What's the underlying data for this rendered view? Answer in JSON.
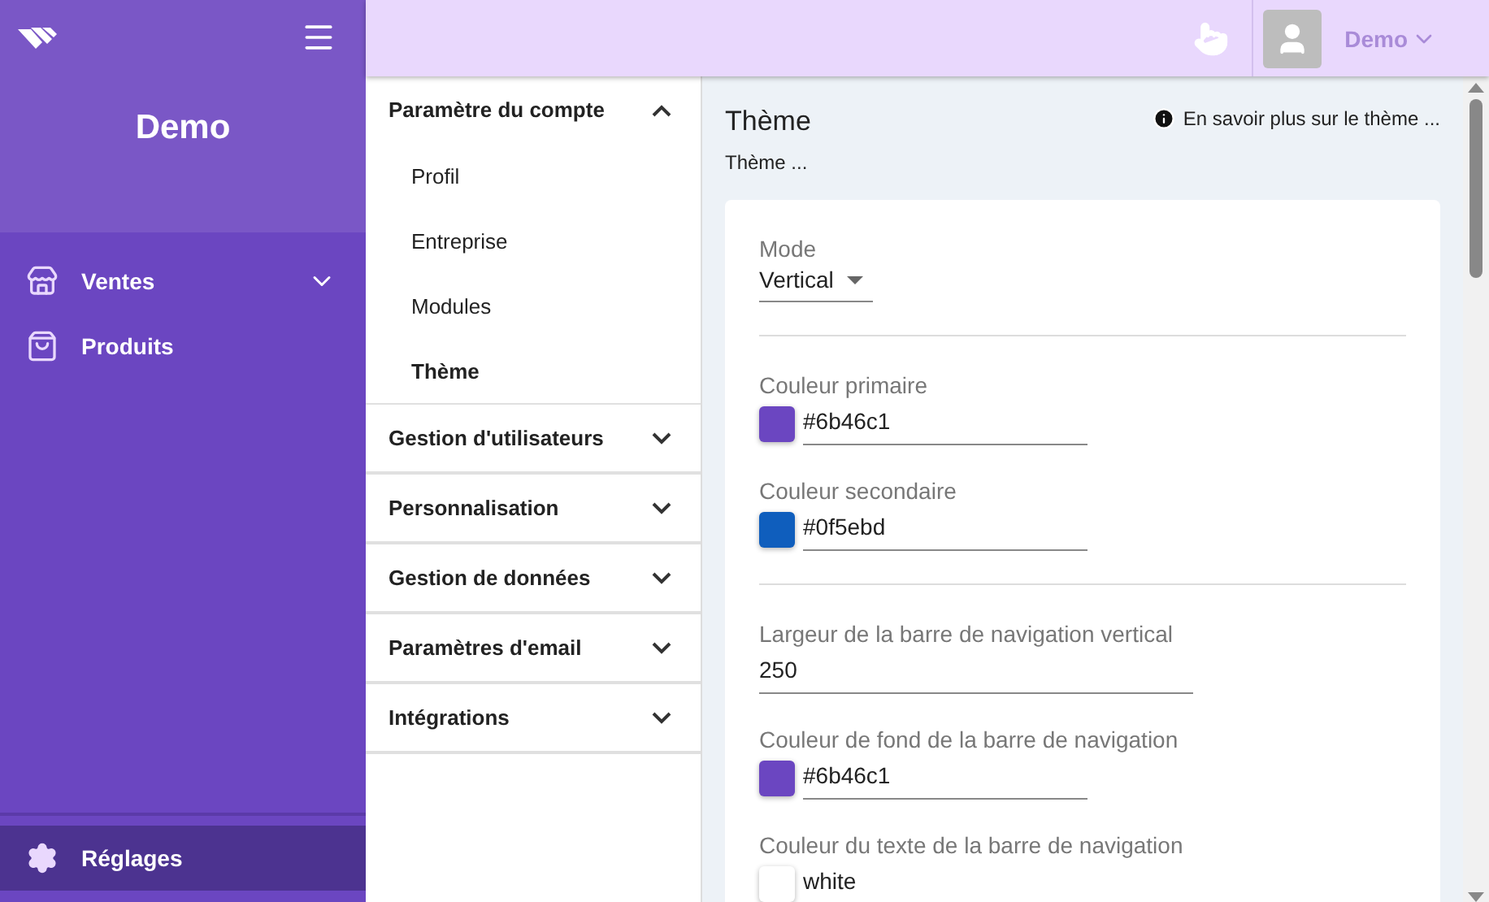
{
  "sidebar": {
    "title": "Demo",
    "items": [
      {
        "label": "Ventes",
        "expandable": true,
        "selected": false
      },
      {
        "label": "Produits",
        "expandable": false,
        "selected": false
      }
    ],
    "footer_item": {
      "label": "Réglages",
      "selected": true
    }
  },
  "top_bar": {
    "user": "Demo"
  },
  "settings_menu": [
    {
      "label": "Paramètre du compte",
      "expanded": true,
      "children": [
        {
          "label": "Profil",
          "selected": false
        },
        {
          "label": "Entreprise",
          "selected": false
        },
        {
          "label": "Modules",
          "selected": false
        },
        {
          "label": "Thème",
          "selected": true
        }
      ]
    },
    {
      "label": "Gestion d'utilisateurs",
      "expanded": false
    },
    {
      "label": "Personnalisation",
      "expanded": false
    },
    {
      "label": "Gestion de données",
      "expanded": false
    },
    {
      "label": "Paramètres d'email",
      "expanded": false
    },
    {
      "label": "Intégrations",
      "expanded": false
    }
  ],
  "content": {
    "title": "Thème",
    "subtitle": "Thème ...",
    "help_link": "En savoir plus sur le thème ...",
    "groups": [
      [
        {
          "kind": "select",
          "label": "Mode",
          "value": "Vertical"
        }
      ],
      [
        {
          "kind": "color",
          "label": "Couleur primaire",
          "value": "#6b46c1",
          "color": "#6b46c1"
        },
        {
          "kind": "color",
          "label": "Couleur secondaire",
          "value": "#0f5ebd",
          "color": "#0f5ebd"
        }
      ],
      [
        {
          "kind": "text",
          "label": "Largeur de la barre de navigation vertical",
          "value": "250"
        },
        {
          "kind": "color",
          "label": "Couleur de fond de la barre de navigation",
          "value": "#6b46c1",
          "color": "#6b46c1"
        },
        {
          "kind": "color",
          "label": "Couleur du texte de la barre de navigation",
          "value": "white",
          "color": "#ffffff"
        }
      ]
    ]
  }
}
